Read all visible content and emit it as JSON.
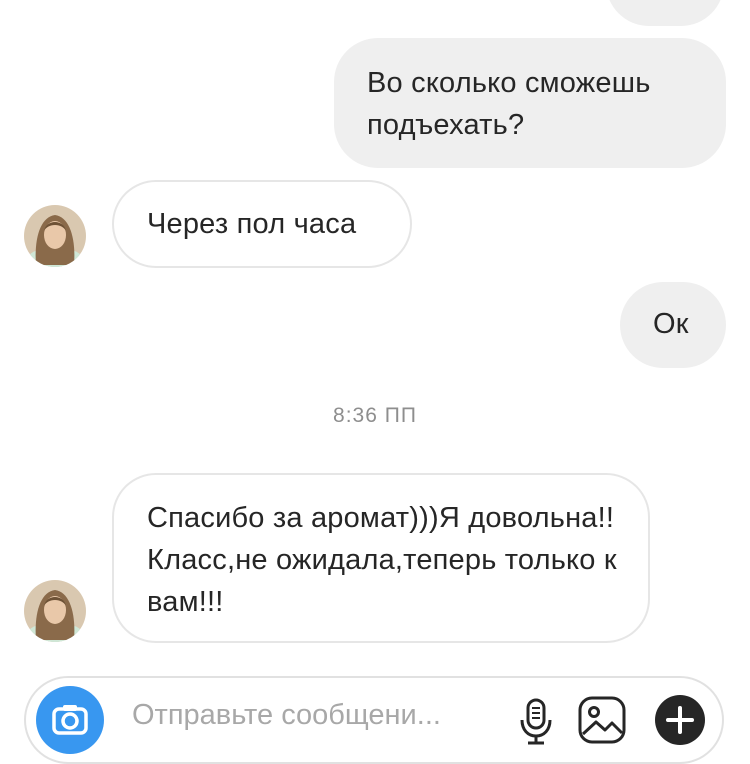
{
  "messages": [
    {
      "id": "m1",
      "side": "out",
      "text": "Во сколько сможешь подъехать?"
    },
    {
      "id": "m2",
      "side": "in",
      "text": "Через пол часа"
    },
    {
      "id": "m3",
      "side": "out",
      "text": "Ок"
    },
    {
      "id": "m4",
      "side": "in",
      "text": "Спасибо за аромат)))Я довольна!!Класс,не ожидала,теперь только к вам!!!"
    }
  ],
  "timestamp": "8:36 ПП",
  "composer": {
    "placeholder": "Отправьте сообщени...",
    "icons": [
      "camera-icon",
      "microphone-icon",
      "gallery-icon",
      "plus-icon"
    ]
  },
  "colors": {
    "accent": "#3897f0",
    "outgoing_bubble": "#efefef",
    "incoming_border": "#e6e6e6",
    "text": "#262626",
    "meta": "#8e8e8e"
  }
}
